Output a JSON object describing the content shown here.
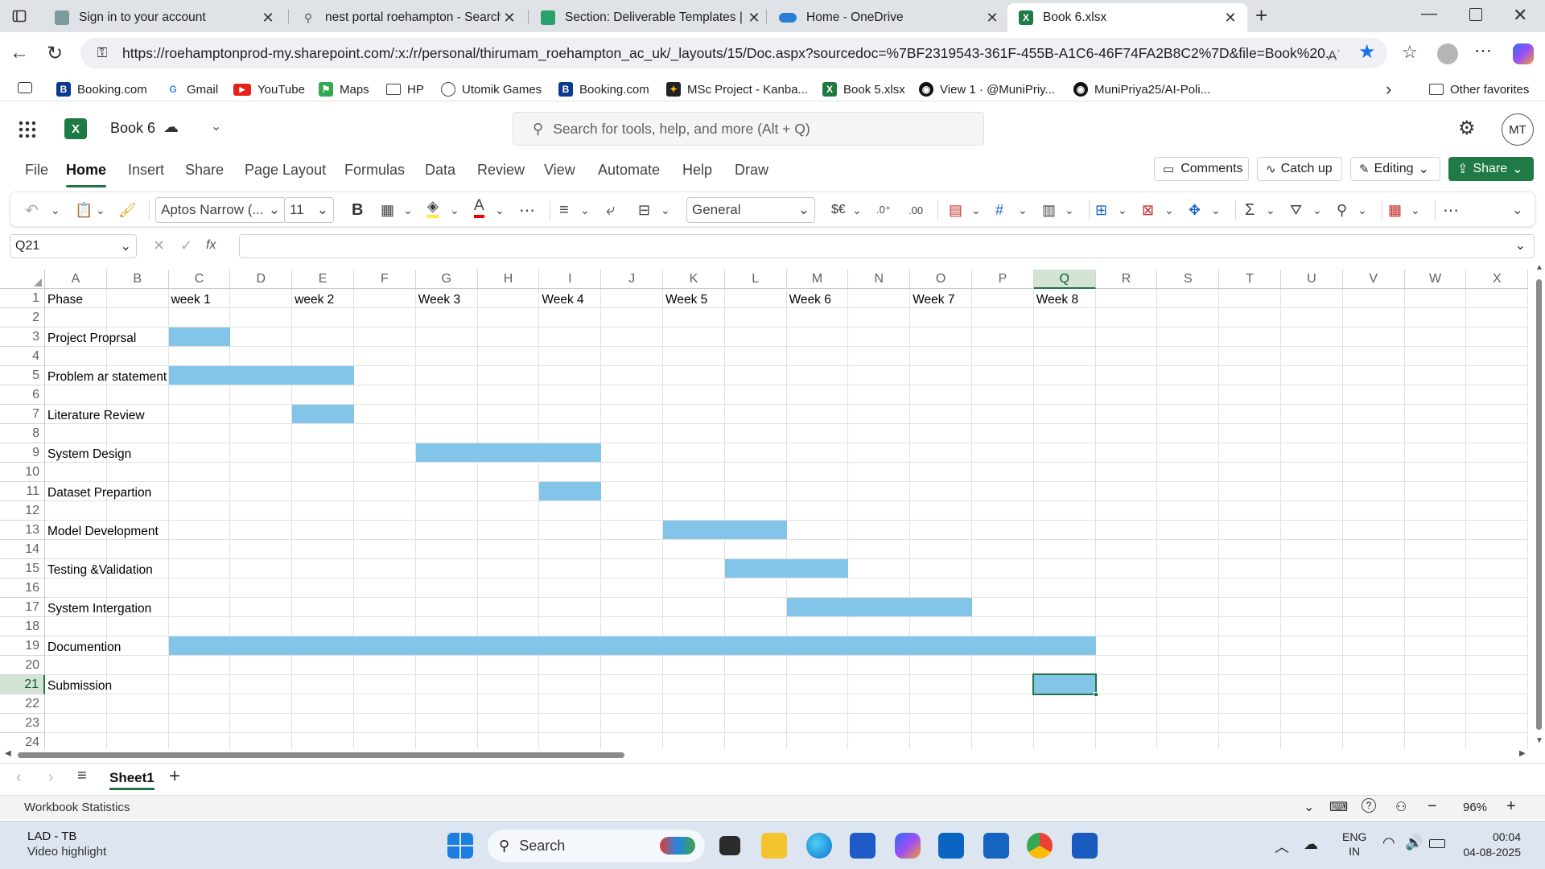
{
  "browser": {
    "tabs": [
      {
        "label": "Sign in to your account"
      },
      {
        "label": "nest portal roehampton - Search"
      },
      {
        "label": "Section: Deliverable Templates | 2"
      },
      {
        "label": "Home - OneDrive"
      },
      {
        "label": "Book 6.xlsx"
      }
    ],
    "url": "https://roehamptonprod-my.sharepoint.com/:x:/r/personal/thirumam_roehampton_ac_uk/_layouts/15/Doc.aspx?sourcedoc=%7BF2319543-361F-455B-A1C6-46F74FA2B8C2%7D&file=Book%20...",
    "favorites": [
      {
        "label": "Booking.com"
      },
      {
        "label": "Gmail"
      },
      {
        "label": "YouTube"
      },
      {
        "label": "Maps"
      },
      {
        "label": "HP"
      },
      {
        "label": "Utomik Games"
      },
      {
        "label": "Booking.com"
      },
      {
        "label": "MSc Project - Kanba..."
      },
      {
        "label": "Book 5.xlsx"
      },
      {
        "label": "View 1 · @MuniPriy..."
      },
      {
        "label": "MuniPriya25/AI-Poli..."
      }
    ],
    "other_favorites": "Other favorites"
  },
  "excel": {
    "file_name": "Book 6",
    "search_placeholder": "Search for tools, help, and more (Alt + Q)",
    "avatar": "MT",
    "menu": [
      "File",
      "Home",
      "Insert",
      "Share",
      "Page Layout",
      "Formulas",
      "Data",
      "Review",
      "View",
      "Automate",
      "Help",
      "Draw"
    ],
    "comments": "Comments",
    "catch_up": "Catch up",
    "editing": "Editing",
    "share": "Share",
    "font_name": "Aptos Narrow (...",
    "font_size": "11",
    "number_format": "General",
    "currency": "$€",
    "name_box": "Q21",
    "fx": "fx",
    "sheet_name": "Sheet1",
    "status_left": "Workbook Statistics",
    "zoom": "96%",
    "columns": [
      "A",
      "B",
      "C",
      "D",
      "E",
      "F",
      "G",
      "H",
      "I",
      "J",
      "K",
      "L",
      "M",
      "N",
      "O",
      "P",
      "Q",
      "R",
      "S",
      "T",
      "U",
      "V",
      "W",
      "X"
    ],
    "rows": [
      "1",
      "2",
      "3",
      "4",
      "5",
      "6",
      "7",
      "8",
      "9",
      "10",
      "11",
      "12",
      "13",
      "14",
      "15",
      "16",
      "17",
      "18",
      "19",
      "20",
      "21",
      "22",
      "23",
      "24"
    ],
    "cells": {
      "A1": "Phase",
      "C1": "week 1",
      "E1": "week 2",
      "G1": "Week 3",
      "I1": "Week 4",
      "K1": "Week 5",
      "M1": "Week 6",
      "O1": "Week 7",
      "Q1": "Week 8",
      "A3": "Project Proprsal",
      "A5": "Problem ar statement",
      "A7": "Literature Review",
      "A9": "System Design",
      "A11": "Dataset Prepartion",
      "A13": "Model Development",
      "A15": "Testing &Validation",
      "A17": "System Intergation",
      "A19": "Documention",
      "A21": "Submission"
    },
    "fill_color": "#83C5E8",
    "filled_ranges": [
      {
        "row": 3,
        "from": "C",
        "to": "C"
      },
      {
        "row": 5,
        "from": "C",
        "to": "E"
      },
      {
        "row": 7,
        "from": "E",
        "to": "E"
      },
      {
        "row": 9,
        "from": "G",
        "to": "I"
      },
      {
        "row": 11,
        "from": "I",
        "to": "I"
      },
      {
        "row": 13,
        "from": "K",
        "to": "L"
      },
      {
        "row": 15,
        "from": "L",
        "to": "M"
      },
      {
        "row": 17,
        "from": "M",
        "to": "O"
      },
      {
        "row": 19,
        "from": "C",
        "to": "Q"
      },
      {
        "row": 21,
        "from": "Q",
        "to": "Q"
      }
    ],
    "selected_cell": "Q21"
  },
  "taskbar": {
    "weather_title": "LAD - TB",
    "weather_sub": "Video highlight",
    "search": "Search",
    "lang_top": "ENG",
    "lang_bottom": "IN",
    "time": "00:04",
    "date": "04-08-2025"
  }
}
